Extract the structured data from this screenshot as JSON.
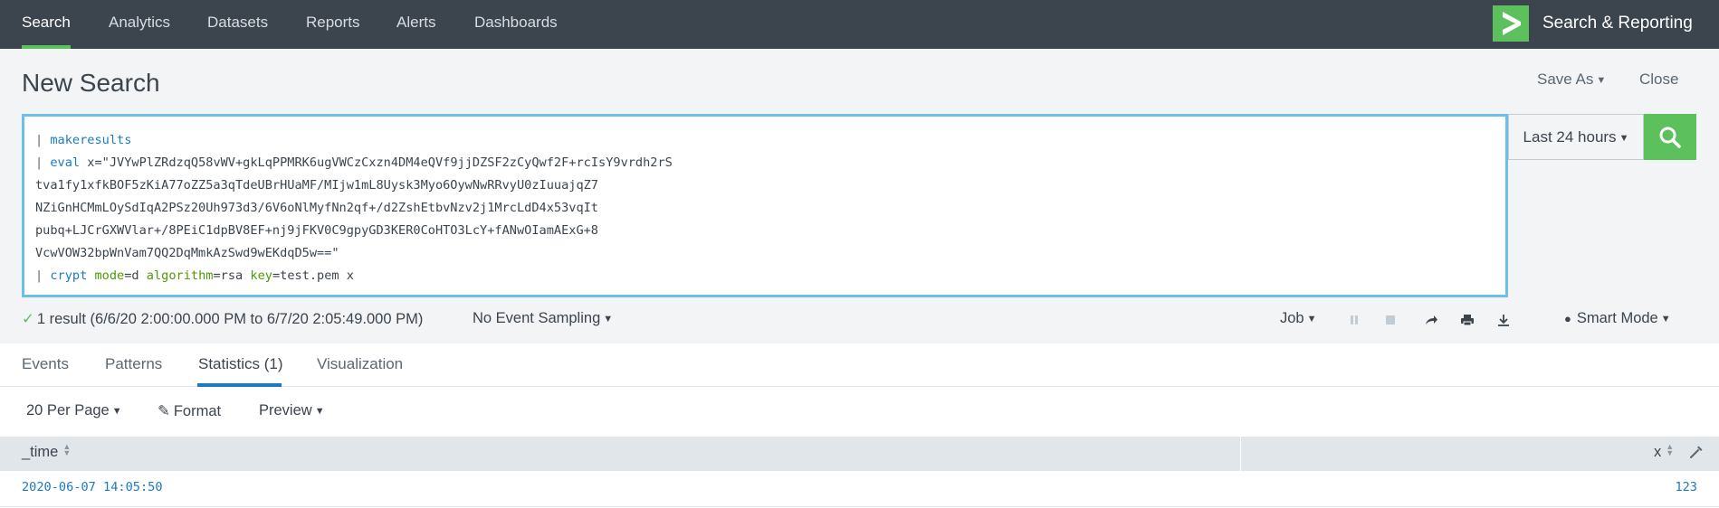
{
  "nav": {
    "items": [
      {
        "label": "Search",
        "active": true
      },
      {
        "label": "Analytics"
      },
      {
        "label": "Datasets"
      },
      {
        "label": "Reports"
      },
      {
        "label": "Alerts"
      },
      {
        "label": "Dashboards"
      }
    ],
    "app_title": "Search & Reporting",
    "logo_icon": "chevron-right-logo"
  },
  "header": {
    "title": "New Search",
    "save_as": "Save As",
    "close": "Close"
  },
  "search": {
    "lines": [
      [
        {
          "t": "| ",
          "c": "pipe"
        },
        {
          "t": "makeresults",
          "c": "cmd"
        }
      ],
      [
        {
          "t": "| ",
          "c": "pipe"
        },
        {
          "t": "eval",
          "c": "cmd"
        },
        {
          "t": " x=\"JVYwPlZRdzqQ58vWV+gkLqPPMRK6ugVWCzCxzn4DM4eQVf9jjDZSF2zCyQwf2F+rcIsY9vrdh2rS",
          "c": ""
        }
      ],
      [
        {
          "t": "tva1fy1xfkBOF5zKiA77oZZ5a3qTdeUBrHUaMF/MIjw1mL8Uysk3Myo6OywNwRRvyU0zIuuajqZ7",
          "c": ""
        }
      ],
      [
        {
          "t": "NZiGnHCMmLOySdIqA2PSz20Uh973d3/6V6oNlMyfNn2qf+/d2ZshEtbvNzv2j1MrcLdD4x53vqIt",
          "c": ""
        }
      ],
      [
        {
          "t": "pubq+LJCrGXWVlar+/8PEiC1dpBV8EF+nj9jFKV0C9gpyGD3KER0CoHTO3LcY+fANwOIamAExG+8",
          "c": ""
        }
      ],
      [
        {
          "t": "VcwVOW32bpWnVam7QQ2DqMmkAzSwd9wEKdqD5w==\"",
          "c": ""
        }
      ],
      [
        {
          "t": "| ",
          "c": "pipe"
        },
        {
          "t": "crypt",
          "c": "cmd"
        },
        {
          "t": " ",
          "c": ""
        },
        {
          "t": "mode",
          "c": "arg"
        },
        {
          "t": "=d ",
          "c": ""
        },
        {
          "t": "algorithm",
          "c": "arg"
        },
        {
          "t": "=rsa ",
          "c": ""
        },
        {
          "t": "key",
          "c": "arg"
        },
        {
          "t": "=test.pem x",
          "c": ""
        }
      ]
    ],
    "time_range": "Last 24 hours",
    "search_icon": "magnifier-icon"
  },
  "status": {
    "result_text": "1 result (6/6/20 2:00:00.000 PM to 6/7/20 2:05:49.000 PM)",
    "sampling": "No Event Sampling",
    "job": "Job",
    "smart_mode": "Smart Mode"
  },
  "tabs": [
    {
      "label": "Events"
    },
    {
      "label": "Patterns"
    },
    {
      "label": "Statistics (1)",
      "active": true
    },
    {
      "label": "Visualization"
    }
  ],
  "results_toolbar": {
    "per_page": "20 Per Page",
    "format": "Format",
    "preview": "Preview"
  },
  "table": {
    "columns": [
      "_time",
      "x"
    ],
    "rows": [
      [
        "2020-06-07 14:05:50",
        "123"
      ]
    ]
  },
  "colors": {
    "nav_bg": "#3c444d",
    "accent_green": "#5cc05c",
    "focus_blue": "#6ac0ea",
    "link_blue": "#1a7ac4"
  }
}
